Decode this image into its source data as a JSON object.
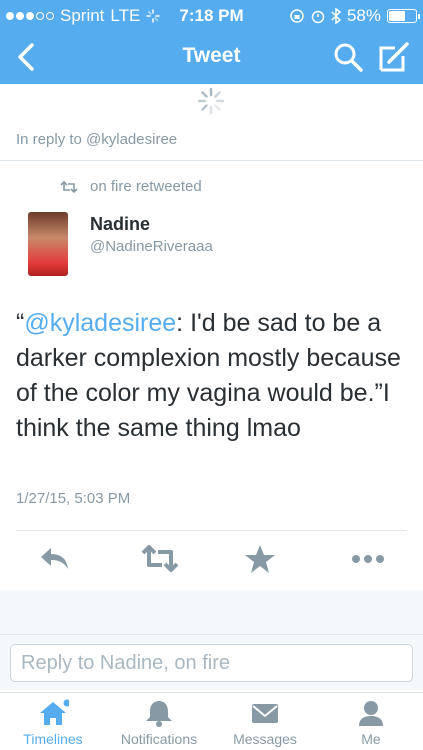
{
  "status_bar": {
    "carrier": "Sprint",
    "network": "LTE",
    "time": "7:18 PM",
    "battery_percent": "58%",
    "battery_level": 0.58
  },
  "nav": {
    "title": "Tweet"
  },
  "reply_context": "In reply to @kyladesiree",
  "tweet": {
    "retweeted_by": "on fire retweeted",
    "author_name": "Nadine",
    "author_handle": "@NadineRiveraaa",
    "quote_open": "“",
    "mention": "@kyladesiree",
    "text_rest": ": I'd be sad to be a darker complexion mostly because of the color my vagina would be.”I think the same thing lmao",
    "timestamp": "1/27/15, 5:03 PM"
  },
  "reply_box": {
    "placeholder": "Reply to Nadine, on fire"
  },
  "tabs": [
    {
      "label": "Timelines",
      "icon": "home-icon",
      "active": true
    },
    {
      "label": "Notifications",
      "icon": "bell-icon",
      "active": false
    },
    {
      "label": "Messages",
      "icon": "envelope-icon",
      "active": false
    },
    {
      "label": "Me",
      "icon": "person-icon",
      "active": false
    }
  ],
  "colors": {
    "brand": "#55acee",
    "muted": "#8899a6",
    "text": "#292f33"
  }
}
